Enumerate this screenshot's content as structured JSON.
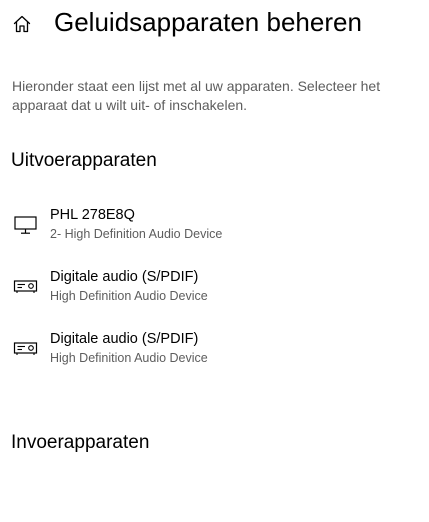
{
  "header": {
    "home_icon": "home-icon",
    "title": "Geluidsapparaten beheren"
  },
  "description": "Hieronder staat een lijst met al uw apparaten. Selecteer het apparaat dat u wilt uit- of inschakelen.",
  "output_section": {
    "heading": "Uitvoerapparaten",
    "devices": [
      {
        "icon": "monitor-icon",
        "name": "PHL 278E8Q",
        "subtitle": "2- High Definition Audio Device"
      },
      {
        "icon": "spdif-device-icon",
        "name": "Digitale audio (S/PDIF)",
        "subtitle": "High Definition Audio Device"
      },
      {
        "icon": "spdif-device-icon",
        "name": "Digitale audio (S/PDIF)",
        "subtitle": "High Definition Audio Device"
      }
    ]
  },
  "input_section": {
    "heading": "Invoerapparaten"
  }
}
